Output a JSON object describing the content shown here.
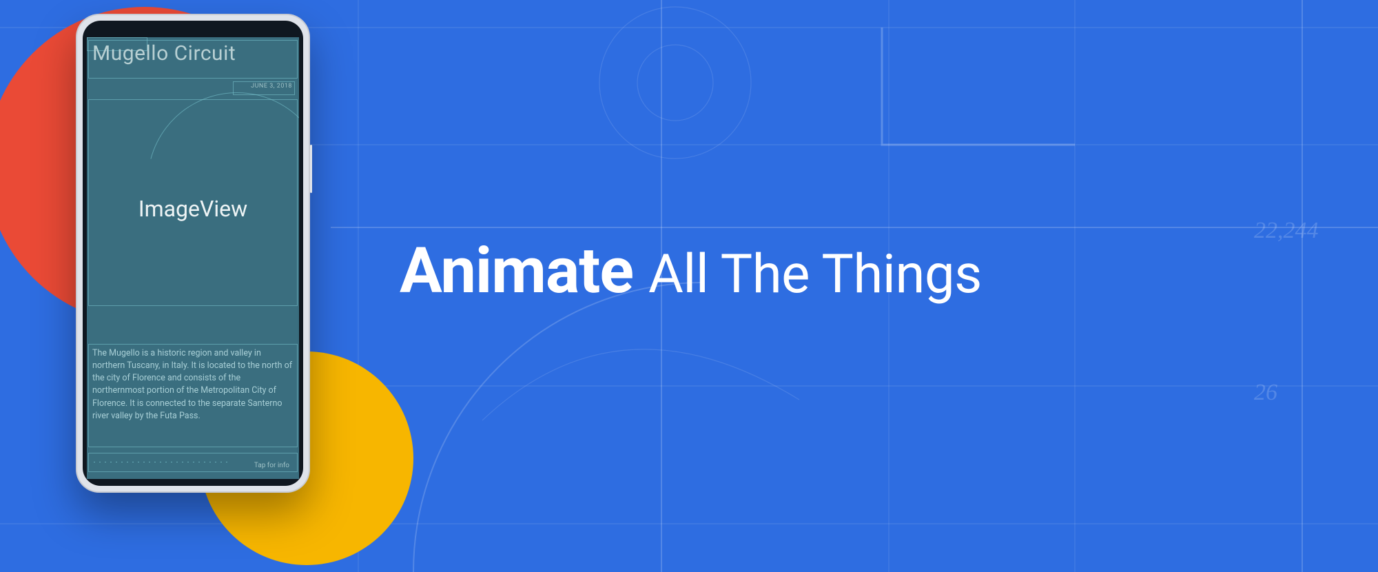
{
  "headline": {
    "bold": "Animate",
    "thin": "All The Things"
  },
  "phone": {
    "title": "Mugello Circuit",
    "date": "JUNE 3, 2018",
    "component_label": "ImageView",
    "description": "The Mugello is a historic region and valley in northern Tuscany, in Italy. It is located to the north of the city of Florence and consists of the northernmost portion of the Metropolitan City of Florence. It is connected to the separate Santerno river valley by the Futa Pass.",
    "tap_hint": "Tap for info"
  },
  "annotations": {
    "num_right_1": "22,244",
    "num_right_2": "26"
  },
  "colors": {
    "bg": "#2e6de1",
    "red": "#ea4a36",
    "yellow": "#f7b600",
    "screen": "#3a6e7f"
  }
}
